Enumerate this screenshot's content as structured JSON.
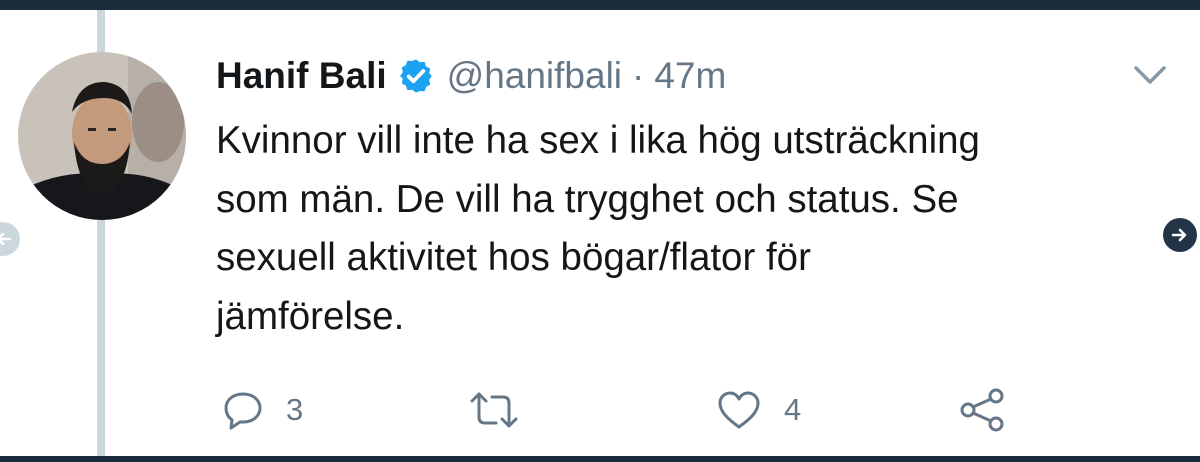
{
  "tweet": {
    "display_name": "Hanif Bali",
    "verified": true,
    "handle": "@hanifbali",
    "separator": "·",
    "time": "47m",
    "text": "Kvinnor vill inte ha sex i lika hög utsträckning\nsom män. De vill ha trygghet och status. Se\nsexuell aktivitet hos bögar/flator för\njämförelse."
  },
  "actions": {
    "reply_count": "3",
    "retweet_count": "",
    "like_count": "4"
  },
  "colors": {
    "text": "#14171a",
    "secondary": "#657786",
    "verified": "#1da1f2",
    "thread_line": "#ccd6dd",
    "frame": "#1a2b3c"
  },
  "icons": [
    "verified-icon",
    "chevron-down-icon",
    "reply-icon",
    "retweet-icon",
    "like-icon",
    "share-icon",
    "arrow-left-icon",
    "arrow-right-icon"
  ]
}
